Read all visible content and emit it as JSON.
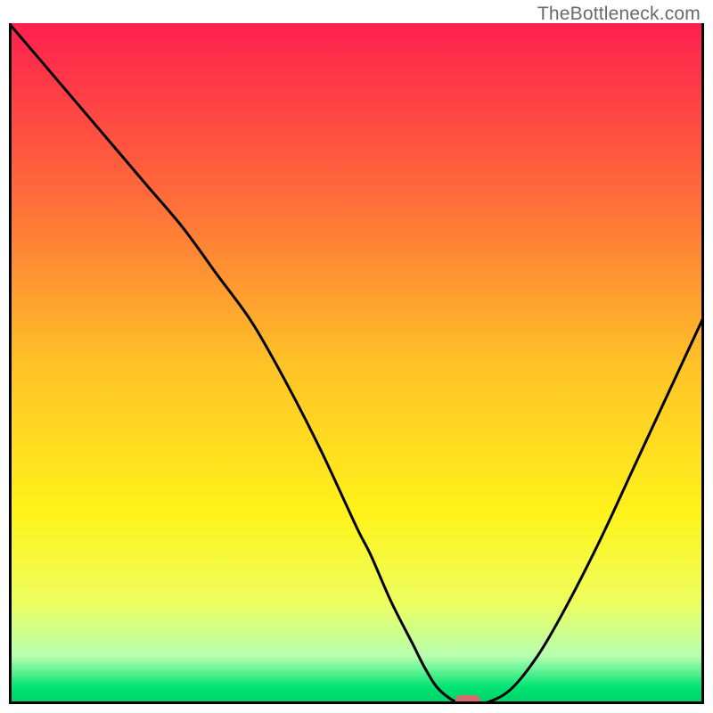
{
  "watermark": "TheBottleneck.com",
  "chart_data": {
    "type": "line",
    "title": "",
    "xlabel": "",
    "ylabel": "",
    "xlim": [
      0,
      100
    ],
    "ylim": [
      0,
      100
    ],
    "grid": false,
    "legend": false,
    "background": {
      "type": "vertical-gradient",
      "stops": [
        {
          "pos": 0.0,
          "color": "#ff1f4e"
        },
        {
          "pos": 0.25,
          "color": "#ff6a3b"
        },
        {
          "pos": 0.5,
          "color": "#ffc227"
        },
        {
          "pos": 0.72,
          "color": "#fff31a"
        },
        {
          "pos": 0.85,
          "color": "#eeff5e"
        },
        {
          "pos": 0.93,
          "color": "#b6ffb0"
        },
        {
          "pos": 0.975,
          "color": "#00e472"
        },
        {
          "pos": 1.0,
          "color": "#00d066"
        }
      ]
    },
    "series": [
      {
        "name": "bottleneck-curve",
        "color": "#000000",
        "x": [
          0,
          5,
          10,
          15,
          20,
          25,
          30,
          35,
          40,
          45,
          50,
          52,
          55,
          58,
          60,
          62,
          65,
          68,
          72,
          76,
          80,
          85,
          90,
          95,
          100
        ],
        "y": [
          100,
          94,
          88,
          82,
          76,
          70,
          63,
          56,
          47,
          37,
          26,
          22,
          15,
          9,
          5,
          2,
          0,
          0,
          2,
          7,
          14,
          24,
          35,
          46,
          57
        ]
      }
    ],
    "marker": {
      "name": "optimum-marker",
      "x": 66,
      "y": 0.4,
      "color": "#d66a6d",
      "shape": "rounded-pill"
    }
  }
}
